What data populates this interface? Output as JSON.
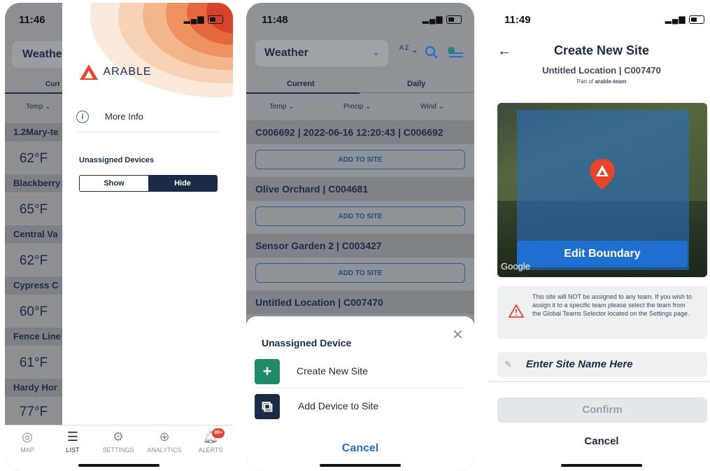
{
  "phone1": {
    "time": "11:46",
    "header_partial": "Weathe",
    "tab_partial": "Curr",
    "temp_partial": "Temp",
    "rows": [
      {
        "name": "1.2Mary-te",
        "temp": "62°F"
      },
      {
        "name": "Blackberry",
        "temp": "65°F"
      },
      {
        "name": "Central Va",
        "temp": "62°F"
      },
      {
        "name": "Cypress C",
        "temp": "60°F"
      },
      {
        "name": "Fence Line",
        "temp": "61°F"
      },
      {
        "name": "Hardy Hor",
        "temp": "77°F"
      }
    ],
    "drawer": {
      "brand": "ARABLE",
      "more_info": "More Info",
      "unassigned_label": "Unassigned Devices",
      "show": "Show",
      "hide": "Hide"
    },
    "tabs": [
      {
        "label": "MAP"
      },
      {
        "label": "LIST"
      },
      {
        "label": "SETTINGS"
      },
      {
        "label": "ANALYTICS"
      },
      {
        "label": "ALERTS"
      }
    ],
    "alerts_badge": "99+"
  },
  "phone2": {
    "time": "11:48",
    "dropdown": "Weather",
    "sort_icon": "A Z",
    "tab_current": "Current",
    "tab_daily": "Daily",
    "col_temp": "Temp",
    "col_precip": "Precip",
    "col_wind": "Wind",
    "sites": [
      {
        "title": "C006692 | 2022-06-16 12:20:43 | C006692",
        "button": "ADD TO SITE"
      },
      {
        "title": "Olive Orchard | C004681",
        "button": "ADD TO SITE"
      },
      {
        "title": "Sensor Garden 2 | C003427",
        "button": "ADD TO SITE"
      },
      {
        "title": "Untitled Location | C007470",
        "button": ""
      }
    ],
    "sheet": {
      "title": "Unassigned Device",
      "create": "Create New Site",
      "add": "Add Device to Site",
      "cancel": "Cancel"
    }
  },
  "phone3": {
    "time": "11:49",
    "title": "Create New Site",
    "subtitle": "Untitled Location | C007470",
    "part_of_prefix": "Part of ",
    "part_of_team": "arable-team",
    "edit_boundary": "Edit Boundary",
    "map_credit": "Google",
    "notice": "This site will NOT be assigned to any team. If you wish to assign it to a specific team please select the team from the Global Teams Selector located on the Settings page.",
    "site_name_placeholder": "Enter Site Name Here",
    "confirm": "Confirm",
    "cancel": "Cancel"
  },
  "colors": {
    "navy": "#1b2b45",
    "brand_orange": "#e8462a",
    "accent_blue": "#1f6fd1",
    "teal": "#1f8a6a"
  }
}
